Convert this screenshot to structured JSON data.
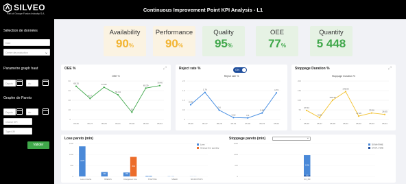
{
  "header": {
    "brand": "SILVEO",
    "brand_sub": "Part of Groupe Fusion Industry S.A.",
    "title": "Continuous Improvement Point KPI Analysis - L1"
  },
  "sidebar": {
    "section_data": "Sélection de données",
    "date_placeholder": "Date",
    "production_center_placeholder": "Centre de production",
    "section_param": "Parametre graph haut",
    "since_label": "Depuis",
    "to_label": "Au",
    "section_pareto": "Graphe de Pareto",
    "choice_placeholder": "Choisir KPI",
    "type_placeholder": "Type KPI",
    "validate_label": "Valider"
  },
  "kpis": [
    {
      "label": "Availability",
      "value": "90",
      "unit": "%",
      "color": "#f2b431",
      "bg": "#fbf3e2"
    },
    {
      "label": "Performance",
      "value": "90",
      "unit": "%",
      "color": "#f2b431",
      "bg": "#fbf3e2"
    },
    {
      "label": "Quality",
      "value": "95",
      "unit": "%",
      "color": "#3fa74a",
      "bg": "#e6f2e4"
    },
    {
      "label": "OEE",
      "value": "77",
      "unit": "%",
      "color": "#3fa74a",
      "bg": "#e6f2e4"
    },
    {
      "label": "Quantity",
      "value": "5 448",
      "unit": "",
      "color": "#3fa74a",
      "bg": "#e6f2e4"
    }
  ],
  "charts": {
    "oee": {
      "title": "OEE %"
    },
    "reject": {
      "title": "Reject rate %",
      "toggle": "ON"
    },
    "stoppage": {
      "title": "Stoppage Duration %"
    },
    "loss": {
      "title": "Lose pareto (min)"
    },
    "stoppage_pareto": {
      "title": "Stoppage pareto (min)"
    }
  },
  "chart_data": [
    {
      "type": "line",
      "title": "OEE %",
      "legend": "OEE %",
      "x": [
        "05-26",
        "05-27",
        "05-28",
        "05-01",
        "05-02",
        "05-03",
        "05-04"
      ],
      "values": [
        69.15,
        43.7,
        67.03,
        51.34,
        15.0,
        65.29,
        70.46
      ],
      "color": "#3fa74a",
      "ylim": [
        0,
        80
      ]
    },
    {
      "type": "line",
      "title": "Reject rate %",
      "legend": "Reject rate %",
      "x": [
        "05-26",
        "05-27",
        "05-28",
        "05-01",
        "05-02",
        "05-03",
        "05-04"
      ],
      "values": [
        0.96,
        1.76,
        0.6,
        0.12,
        0.1,
        0.42,
        1.73
      ],
      "color": "#3a86e0",
      "ylim": [
        0,
        2.5
      ]
    },
    {
      "type": "line",
      "title": "Stoppage Duration %",
      "legend": "Stoppage Duration %",
      "x": [
        "05-26",
        "05-27",
        "05-28",
        "05-01",
        "05-02",
        "05-03",
        "05-04"
      ],
      "values": [
        47.04,
        9.58,
        100.46,
        145.06,
        17.46,
        33.56,
        26.05
      ],
      "color": "#f2c12e",
      "ylim": [
        0,
        200
      ]
    },
    {
      "type": "bar",
      "title": "Lose pareto (min)",
      "categories": [
        "Loss of inertia",
        "BREAKS",
        "Changeover time",
        "STARTING",
        "SPEED",
        "MICROSTOPS"
      ],
      "series": [
        {
          "name": "Loss",
          "values": [
            1370,
            200,
            180,
            30,
            10,
            5
          ],
          "color": "#4a89d8"
        },
        {
          "name": "Change line quantity",
          "values": [
            0,
            0,
            890,
            0,
            0,
            0
          ],
          "color": "#ec6d2b"
        }
      ],
      "ylim": [
        0,
        1500
      ]
    },
    {
      "type": "bar",
      "title": "Stoppage pareto (min)",
      "categories": [
        "NO_INF"
      ],
      "series": [
        {
          "name": "DOWNTIME",
          "values": [
            1290
          ],
          "color": "#4a89d8"
        },
        {
          "name": "STOP_TIME",
          "values": [
            60
          ],
          "color": "#1f4e9c"
        }
      ],
      "ylim": [
        0,
        2000
      ]
    }
  ]
}
